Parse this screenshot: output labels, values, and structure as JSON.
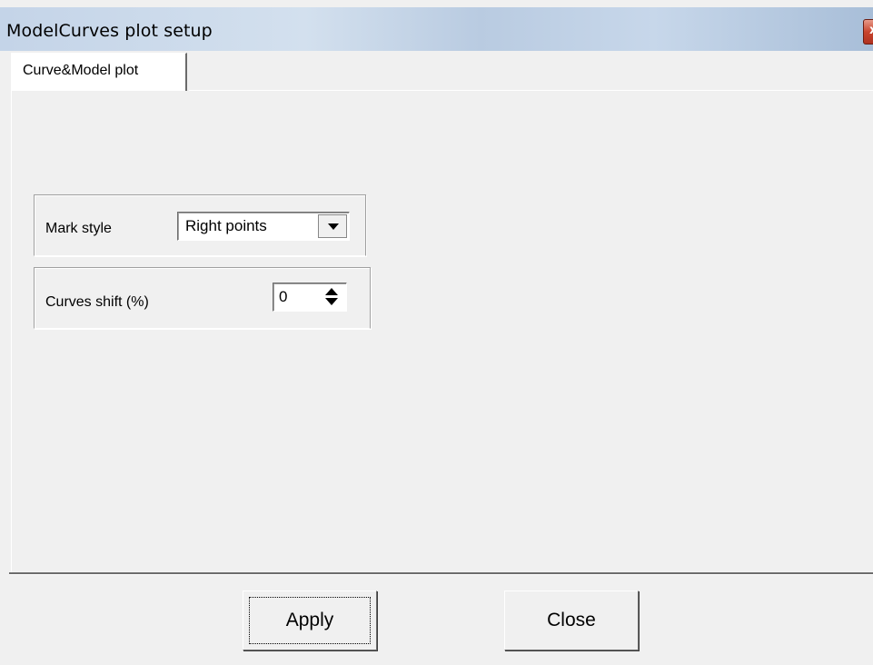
{
  "window": {
    "title": "ModelCurves plot setup",
    "close_glyph": "x"
  },
  "tabs": [
    {
      "label": "Curve&Model plot",
      "active": true
    }
  ],
  "mark_style": {
    "label": "Mark style",
    "selected_value": "Right points"
  },
  "curves_shift": {
    "label": "Curves shift (%)",
    "value": "0"
  },
  "buttons": {
    "apply_label": "Apply",
    "close_label": "Close"
  },
  "icons": {
    "dropdown": "chevron-down-icon",
    "spinner": "spin-up-down-icon",
    "window_close": "close-icon"
  },
  "colors": {
    "window_background": "#f0f0f0",
    "titlebar": "#c4d4e8",
    "close_button": "#c8452e"
  }
}
